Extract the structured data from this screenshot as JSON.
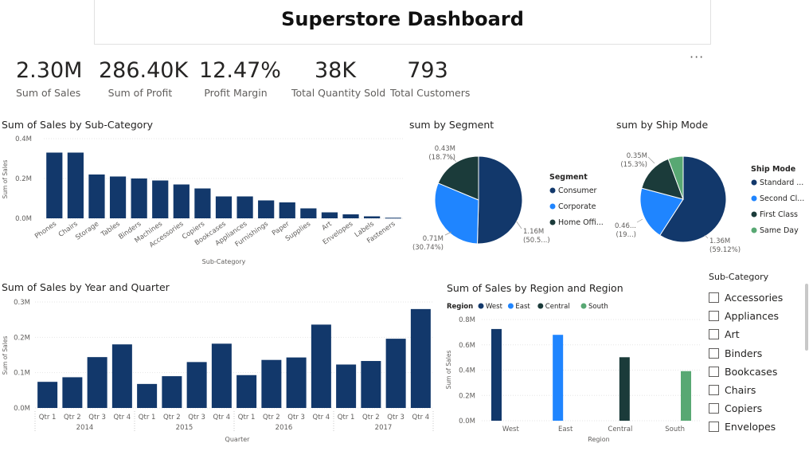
{
  "header": {
    "title": "Superstore Dashboard",
    "more_label": "···"
  },
  "kpis": [
    {
      "value": "2.30M",
      "label": "Sum of Sales"
    },
    {
      "value": "286.40K",
      "label": "Sum of Profit"
    },
    {
      "value": "12.47%",
      "label": "Profit Margin"
    },
    {
      "value": "38K",
      "label": "Total Quantity Sold"
    },
    {
      "value": "793",
      "label": "Total Customers"
    }
  ],
  "slicer": {
    "title": "Sub-Category",
    "items": [
      "Accessories",
      "Appliances",
      "Art",
      "Binders",
      "Bookcases",
      "Chairs",
      "Copiers",
      "Envelopes"
    ]
  },
  "colors": {
    "navy": "#12386b",
    "blue": "#1f85ff",
    "dark_teal": "#1b3b3a",
    "green": "#58a873",
    "axis_text": "#605e5c"
  },
  "chart_data": [
    {
      "id": "subcategory",
      "type": "bar",
      "title": "Sum of Sales by Sub-Category",
      "xlabel": "Sub-Category",
      "ylabel": "Sum of Sales",
      "ylim": [
        0,
        0.4
      ],
      "yticks": [
        "0.0M",
        "0.2M",
        "0.4M"
      ],
      "categories": [
        "Phones",
        "Chairs",
        "Storage",
        "Tables",
        "Binders",
        "Machines",
        "Accessories",
        "Copiers",
        "Bookcases",
        "Appliances",
        "Furnishings",
        "Paper",
        "Supplies",
        "Art",
        "Envelopes",
        "Labels",
        "Fasteners"
      ],
      "values": [
        0.33,
        0.33,
        0.22,
        0.21,
        0.2,
        0.19,
        0.17,
        0.15,
        0.11,
        0.11,
        0.09,
        0.08,
        0.05,
        0.03,
        0.02,
        0.01,
        0.003
      ]
    },
    {
      "id": "segment",
      "type": "pie",
      "title": "sum by Segment",
      "legend_title": "Segment",
      "legend": [
        "Consumer",
        "Corporate",
        "Home Offi..."
      ],
      "slices": [
        {
          "name": "Consumer",
          "value": 1.16,
          "pct": 50.5,
          "label1": "1.16M",
          "label2": "(50.5...)",
          "color": "#12386b"
        },
        {
          "name": "Corporate",
          "value": 0.71,
          "pct": 30.74,
          "label1": "0.71M",
          "label2": "(30.74%)",
          "color": "#1f85ff"
        },
        {
          "name": "Home Office",
          "value": 0.43,
          "pct": 18.79,
          "label1": "0.43M",
          "label2": "(18.7%)",
          "color": "#1b3b3a"
        }
      ]
    },
    {
      "id": "shipmode",
      "type": "pie",
      "title": "sum by Ship Mode",
      "legend_title": "Ship Mode",
      "legend": [
        "Standard ...",
        "Second Cl...",
        "First Class",
        "Same Day"
      ],
      "slices": [
        {
          "name": "Standard Class",
          "value": 1.36,
          "pct": 59.12,
          "label1": "1.36M",
          "label2": "(59.12%)",
          "color": "#12386b"
        },
        {
          "name": "Second Class",
          "value": 0.46,
          "pct": 19.5,
          "label1": "0.46...",
          "label2": "(19...)",
          "color": "#1f85ff"
        },
        {
          "name": "First Class",
          "value": 0.35,
          "pct": 15.3,
          "label1": "0.35M",
          "label2": "(15.3%)",
          "color": "#1b3b3a"
        },
        {
          "name": "Same Day",
          "value": 0.13,
          "pct": 6.08,
          "label1": "",
          "label2": "",
          "color": "#58a873"
        }
      ]
    },
    {
      "id": "yearquarter",
      "type": "bar",
      "title": "Sum of Sales by Year and Quarter",
      "xlabel": "Quarter",
      "ylabel": "Sum of Sales",
      "ylim": [
        0,
        0.3
      ],
      "yticks": [
        "0.0M",
        "0.1M",
        "0.2M",
        "0.3M"
      ],
      "categories": [
        "Qtr 1",
        "Qtr 2",
        "Qtr 3",
        "Qtr 4",
        "Qtr 1",
        "Qtr 2",
        "Qtr 3",
        "Qtr 4",
        "Qtr 1",
        "Qtr 2",
        "Qtr 3",
        "Qtr 4",
        "Qtr 1",
        "Qtr 2",
        "Qtr 3",
        "Qtr 4"
      ],
      "groups": [
        "2014",
        "2015",
        "2016",
        "2017"
      ],
      "values": [
        0.074,
        0.087,
        0.144,
        0.18,
        0.068,
        0.09,
        0.13,
        0.182,
        0.093,
        0.136,
        0.143,
        0.236,
        0.123,
        0.133,
        0.196,
        0.28
      ]
    },
    {
      "id": "region",
      "type": "bar",
      "title": "Sum of Sales by Region and Region",
      "xlabel": "Region",
      "ylabel": "Sum of Sales",
      "legend_title": "Region",
      "ylim": [
        0,
        0.8
      ],
      "yticks": [
        "0.0M",
        "0.2M",
        "0.4M",
        "0.6M",
        "0.8M"
      ],
      "categories": [
        "West",
        "East",
        "Central",
        "South"
      ],
      "series": [
        {
          "name": "West",
          "color": "#12386b",
          "values": [
            0.725,
            null,
            null,
            null
          ]
        },
        {
          "name": "East",
          "color": "#1f85ff",
          "values": [
            null,
            0.679,
            null,
            null
          ]
        },
        {
          "name": "Central",
          "color": "#1b3b3a",
          "values": [
            null,
            null,
            0.502,
            null
          ]
        },
        {
          "name": "South",
          "color": "#58a873",
          "values": [
            null,
            null,
            null,
            0.392
          ]
        }
      ]
    }
  ]
}
